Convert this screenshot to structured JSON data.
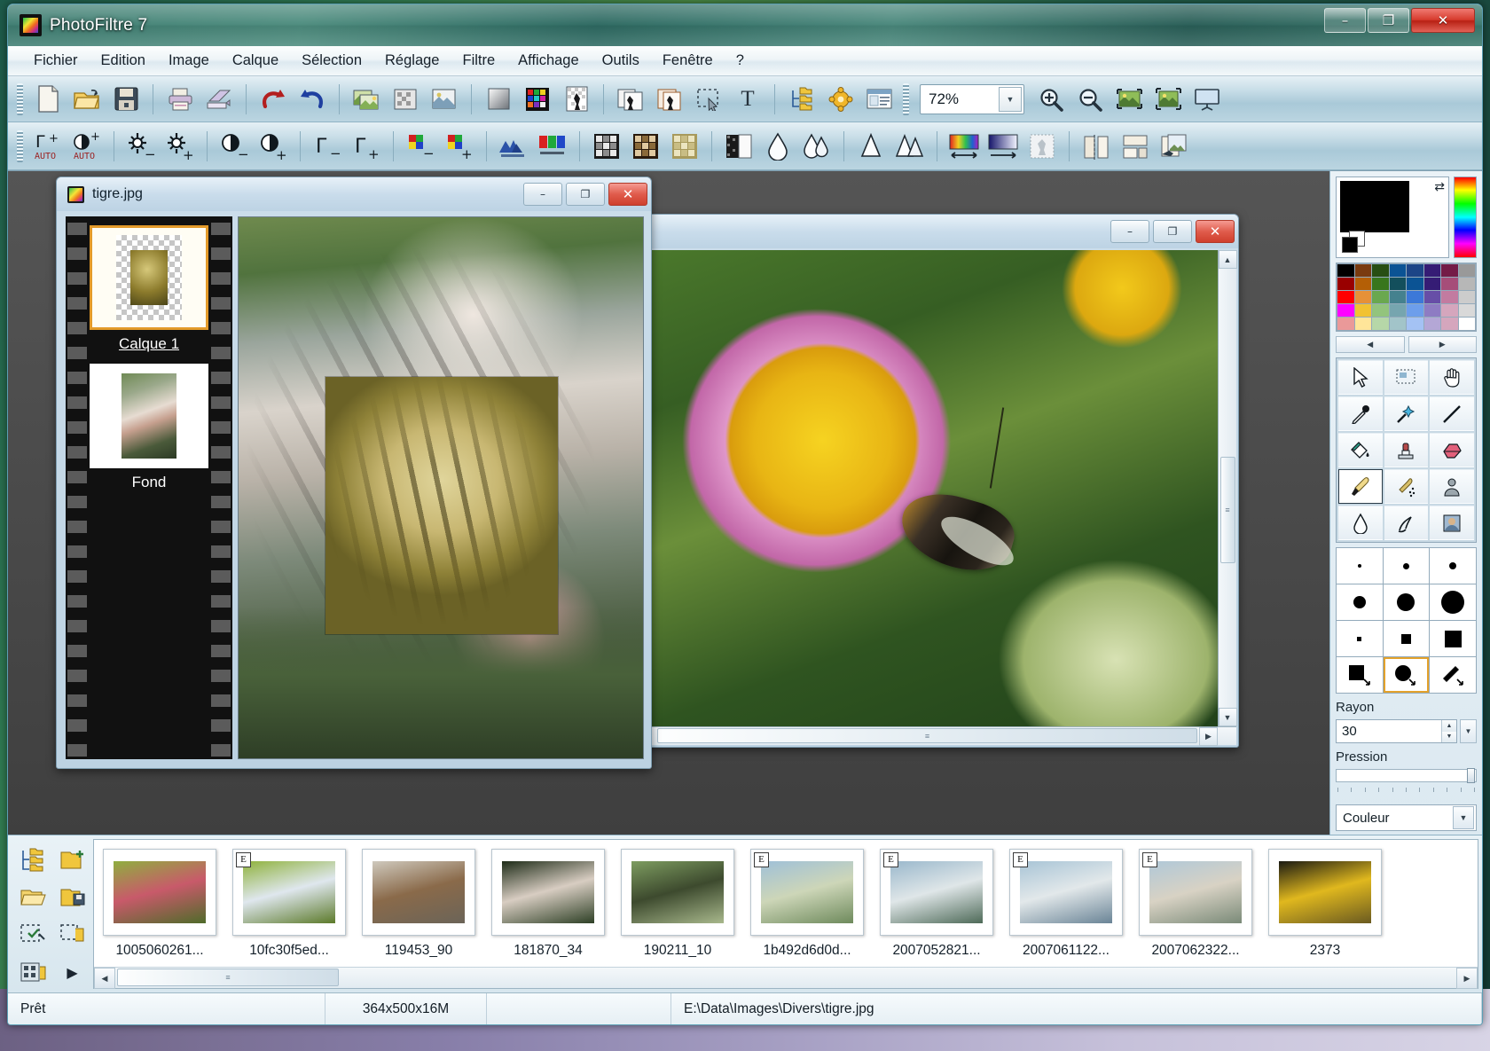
{
  "window": {
    "title": "PhotoFiltre 7",
    "app_icon": "photofiltre-logo-icon",
    "minimize": "–",
    "maximize": "❐",
    "close": "✕"
  },
  "menu": {
    "items": [
      {
        "label": "Fichier"
      },
      {
        "label": "Edition"
      },
      {
        "label": "Image"
      },
      {
        "label": "Calque"
      },
      {
        "label": "Sélection"
      },
      {
        "label": "Réglage"
      },
      {
        "label": "Filtre"
      },
      {
        "label": "Affichage"
      },
      {
        "label": "Outils"
      },
      {
        "label": "Fenêtre"
      },
      {
        "label": "?"
      }
    ]
  },
  "toolbar_main": {
    "zoom_value": "72%",
    "zoom_arrow": "▼",
    "buttons": [
      {
        "name": "new-file-icon"
      },
      {
        "name": "open-file-icon"
      },
      {
        "name": "save-file-icon"
      },
      {
        "name": "print-icon"
      },
      {
        "name": "scanner-icon"
      },
      {
        "name": "undo-icon"
      },
      {
        "name": "redo-icon"
      },
      {
        "name": "copy-image-icon"
      },
      {
        "name": "paste-image-icon"
      },
      {
        "name": "paste-special-icon"
      },
      {
        "name": "gradient-icon"
      },
      {
        "name": "color-palette-icon"
      },
      {
        "name": "transparency-icon"
      },
      {
        "name": "duplicate-layer-icon"
      },
      {
        "name": "new-layer-icon"
      },
      {
        "name": "selection-icon"
      },
      {
        "name": "text-tool-icon"
      },
      {
        "name": "layer-manager-icon"
      },
      {
        "name": "plugins-icon"
      },
      {
        "name": "preferences-icon"
      },
      {
        "name": "zoom-in-icon"
      },
      {
        "name": "zoom-out-icon"
      },
      {
        "name": "fit-width-icon"
      },
      {
        "name": "fit-screen-icon"
      },
      {
        "name": "slideshow-icon"
      }
    ]
  },
  "toolbar_adjust": {
    "buttons": [
      {
        "name": "auto-gamma-icon",
        "label": "AUTO"
      },
      {
        "name": "auto-contrast-icon",
        "label": "AUTO"
      },
      {
        "name": "brightness-minus-icon"
      },
      {
        "name": "brightness-plus-icon"
      },
      {
        "name": "contrast-minus-icon"
      },
      {
        "name": "contrast-plus-icon"
      },
      {
        "name": "gamma-minus-icon"
      },
      {
        "name": "gamma-plus-icon"
      },
      {
        "name": "saturation-minus-icon"
      },
      {
        "name": "saturation-plus-icon"
      },
      {
        "name": "histogram-icon"
      },
      {
        "name": "rgb-levels-icon"
      },
      {
        "name": "grayscale-icon"
      },
      {
        "name": "sepia-icon"
      },
      {
        "name": "old-photo-icon"
      },
      {
        "name": "dither-icon"
      },
      {
        "name": "blur-icon"
      },
      {
        "name": "blur-more-icon"
      },
      {
        "name": "sharpen-icon"
      },
      {
        "name": "sharpen-more-icon"
      },
      {
        "name": "linear-gradient-icon"
      },
      {
        "name": "radial-gradient-icon"
      },
      {
        "name": "texture-icon"
      },
      {
        "name": "mirror-icon"
      },
      {
        "name": "flip-icon"
      },
      {
        "name": "transform-icon"
      },
      {
        "name": "batch-icon"
      }
    ]
  },
  "tigre_window": {
    "title": "tigre.jpg",
    "minimize": "–",
    "maximize": "❐",
    "close": "✕",
    "layers": [
      {
        "label": "Calque 1",
        "selected": true,
        "thumb": "transparent-checker"
      },
      {
        "label": "Fond",
        "selected": false,
        "thumb": "tiger-photo"
      }
    ]
  },
  "flower_window": {
    "title": "",
    "minimize": "–",
    "maximize": "❐",
    "close": "✕",
    "scroll_up": "▲",
    "scroll_down": "▼",
    "scroll_left": "◀",
    "scroll_right": "▶",
    "thumb_grip": "≡"
  },
  "dock": {
    "swap_icon": "⇄",
    "foreground_color": "#000000",
    "background_color": "#ffffff",
    "palette_colors": [
      "#000000",
      "#7a3b10",
      "#274e13",
      "#0b5394",
      "#1c4587",
      "#351c75",
      "#741b47",
      "#999999",
      "#990000",
      "#b45f06",
      "#38761d",
      "#134f5c",
      "#0b5394",
      "#351c75",
      "#a64d79",
      "#b7b7b7",
      "#ff0000",
      "#e69138",
      "#6aa84f",
      "#45818e",
      "#3c78d8",
      "#674ea7",
      "#c27ba0",
      "#cccccc",
      "#ff00ff",
      "#f1c232",
      "#93c47d",
      "#76a5af",
      "#6d9eeb",
      "#8e7cc3",
      "#d5a6bd",
      "#d9d9d9",
      "#ea9999",
      "#ffe599",
      "#b6d7a8",
      "#a2c4c9",
      "#a4c2f4",
      "#b4a7d6",
      "#d5a6bd",
      "#ffffff"
    ],
    "palette_prev": "◀",
    "palette_next": "▶",
    "tools": [
      {
        "name": "pointer-tool-icon",
        "active": false
      },
      {
        "name": "selection-tool-icon",
        "active": false
      },
      {
        "name": "hand-tool-icon",
        "active": false
      },
      {
        "name": "eyedropper-tool-icon",
        "active": false
      },
      {
        "name": "magic-wand-tool-icon",
        "active": false
      },
      {
        "name": "line-tool-icon",
        "active": false
      },
      {
        "name": "paint-bucket-tool-icon",
        "active": false
      },
      {
        "name": "stamp-tool-icon",
        "active": false
      },
      {
        "name": "eraser-tool-icon",
        "active": false
      },
      {
        "name": "paintbrush-tool-icon",
        "active": true
      },
      {
        "name": "airbrush-tool-icon",
        "active": false
      },
      {
        "name": "clone-tool-icon",
        "active": false
      },
      {
        "name": "blur-tool-icon",
        "active": false
      },
      {
        "name": "smudge-tool-icon",
        "active": false
      },
      {
        "name": "red-eye-tool-icon",
        "active": false
      }
    ],
    "brushes": [
      {
        "name": "brush-dot-tiny",
        "shape": "dot",
        "size": 4,
        "active": false
      },
      {
        "name": "brush-dot-small",
        "shape": "dot",
        "size": 7,
        "active": false
      },
      {
        "name": "brush-dot-medium",
        "shape": "dot",
        "size": 8,
        "active": false
      },
      {
        "name": "brush-dot-large",
        "shape": "dot",
        "size": 14,
        "active": false
      },
      {
        "name": "brush-dot-xlarge",
        "shape": "dot",
        "size": 20,
        "active": false
      },
      {
        "name": "brush-dot-xxlarge",
        "shape": "dot",
        "size": 26,
        "active": false
      },
      {
        "name": "brush-square-tiny",
        "shape": "sq",
        "size": 5,
        "active": false
      },
      {
        "name": "brush-square-small",
        "shape": "sq",
        "size": 11,
        "active": false
      },
      {
        "name": "brush-square-large",
        "shape": "sq",
        "size": 19,
        "active": false
      },
      {
        "name": "brush-square-corner",
        "shape": "sq-arrow",
        "size": 20,
        "active": false
      },
      {
        "name": "brush-round-corner",
        "shape": "dot-arrow",
        "size": 20,
        "active": true
      },
      {
        "name": "brush-diagonal",
        "shape": "diag",
        "size": 20,
        "active": false
      }
    ],
    "rayon_label": "Rayon",
    "rayon_value": "30",
    "spin_up": "▲",
    "spin_down": "▼",
    "rayon_dropdown": "▼",
    "pression_label": "Pression",
    "mode_value": "Couleur",
    "mode_arrow": "▼"
  },
  "browser": {
    "side_buttons": [
      {
        "name": "folder-tree-icon"
      },
      {
        "name": "folder-add-icon"
      },
      {
        "name": "folder-open-icon"
      },
      {
        "name": "folder-save-icon"
      },
      {
        "name": "select-all-icon"
      },
      {
        "name": "deselect-icon"
      },
      {
        "name": "batch-folder-icon"
      },
      {
        "name": "expand-arrow-icon",
        "glyph": "▶"
      }
    ],
    "scroll_left": "◀",
    "scroll_right": "▶",
    "thumb_grip": "≡",
    "thumbnails": [
      {
        "name": "1005060261...",
        "badge": "",
        "colors": [
          "#8fae3f",
          "#c85a6a",
          "#4f6b2a"
        ]
      },
      {
        "name": "10fc30f5ed...",
        "badge": "E",
        "colors": [
          "#8fb23c",
          "#dfe7ee",
          "#5c7a2a"
        ]
      },
      {
        "name": "119453_90",
        "badge": "",
        "colors": [
          "#cfc9bd",
          "#8a6a4a",
          "#6b6458"
        ]
      },
      {
        "name": "181870_34",
        "badge": "",
        "colors": [
          "#1e2c18",
          "#d8cdc2",
          "#2e4026"
        ]
      },
      {
        "name": "190211_10",
        "badge": "",
        "colors": [
          "#7d9c60",
          "#3d4a2e",
          "#a8b88c"
        ]
      },
      {
        "name": "1b492d6d0d...",
        "badge": "E",
        "colors": [
          "#9fc0d8",
          "#cdd6b8",
          "#6e8a5c"
        ]
      },
      {
        "name": "2007052821...",
        "badge": "E",
        "colors": [
          "#9ab8cc",
          "#dfe6e8",
          "#4e6a58"
        ]
      },
      {
        "name": "2007061122...",
        "badge": "E",
        "colors": [
          "#a8c4d6",
          "#e2e8ea",
          "#6a8496"
        ]
      },
      {
        "name": "2007062322...",
        "badge": "E",
        "colors": [
          "#b0c8d8",
          "#d8d2c4",
          "#7a8a78"
        ]
      },
      {
        "name": "2373",
        "badge": "",
        "colors": [
          "#1a1a12",
          "#e0b81e",
          "#6a5a20"
        ]
      }
    ]
  },
  "status": {
    "ready": "Prêt",
    "dimensions": "364x500x16M",
    "path": "E:\\Data\\Images\\Divers\\tigre.jpg"
  }
}
